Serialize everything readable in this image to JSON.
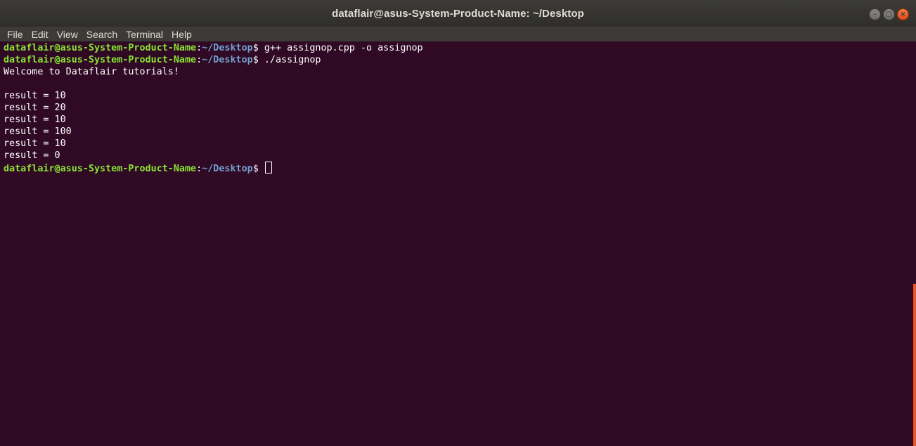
{
  "window": {
    "title": "dataflair@asus-System-Product-Name: ~/Desktop"
  },
  "controls": {
    "minimize_icon": "minimize-icon",
    "maximize_icon": "maximize-icon",
    "close_icon": "close-icon"
  },
  "menubar": {
    "items": [
      "File",
      "Edit",
      "View",
      "Search",
      "Terminal",
      "Help"
    ]
  },
  "terminal": {
    "prompt_user": "dataflair@asus-System-Product-Name",
    "prompt_colon": ":",
    "prompt_path": "~/Desktop",
    "prompt_symbol": "$",
    "lines": [
      {
        "type": "prompt",
        "command": " g++ assignop.cpp -o assignop"
      },
      {
        "type": "prompt",
        "command": " ./assignop"
      },
      {
        "type": "output",
        "text": "Welcome to Dataflair tutorials!"
      },
      {
        "type": "output",
        "text": ""
      },
      {
        "type": "output",
        "text": "result = 10"
      },
      {
        "type": "output",
        "text": "result = 20"
      },
      {
        "type": "output",
        "text": "result = 10"
      },
      {
        "type": "output",
        "text": "result = 100"
      },
      {
        "type": "output",
        "text": "result = 10"
      },
      {
        "type": "output",
        "text": "result = 0"
      },
      {
        "type": "prompt",
        "command": " "
      }
    ]
  },
  "colors": {
    "background": "#300a24",
    "prompt_user": "#8ae234",
    "prompt_path": "#729fcf",
    "scroll_thumb": "#e95420"
  }
}
